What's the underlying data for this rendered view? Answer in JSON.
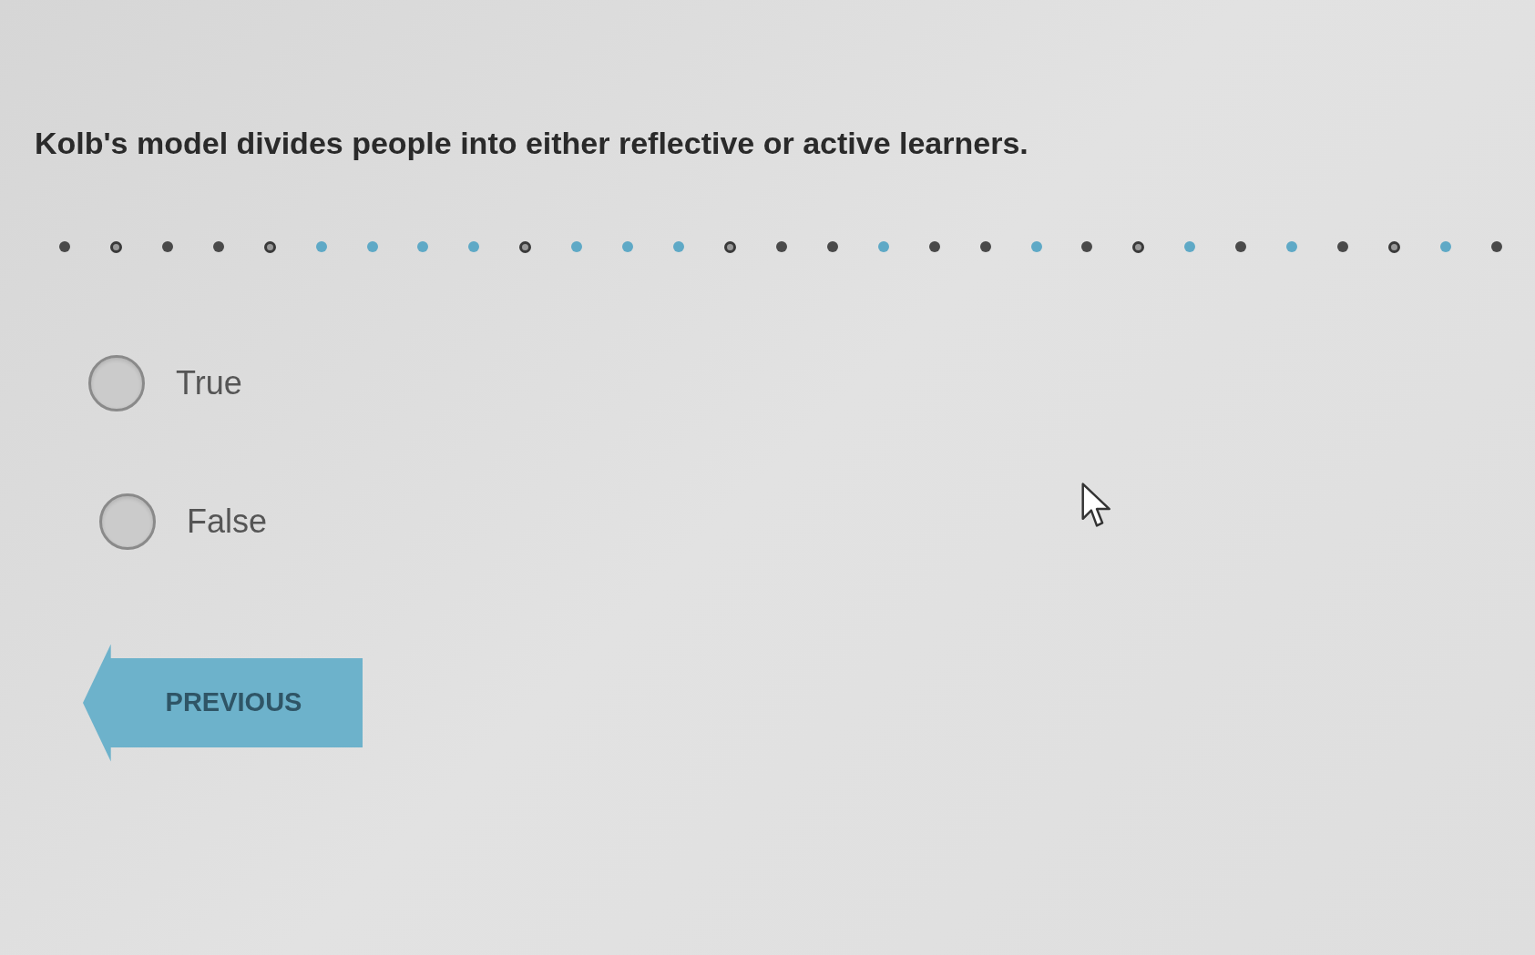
{
  "question": "Kolb's model divides people into either reflective or active learners.",
  "progress": [
    {
      "kind": "dot",
      "color": "#4a4a4a"
    },
    {
      "kind": "ring",
      "color": "#3a3a3a"
    },
    {
      "kind": "dot",
      "color": "#4a4a4a"
    },
    {
      "kind": "dot",
      "color": "#4a4a4a"
    },
    {
      "kind": "ring",
      "color": "#3a3a3a"
    },
    {
      "kind": "dot",
      "color": "#5fa9c6"
    },
    {
      "kind": "dot",
      "color": "#5fa9c6"
    },
    {
      "kind": "dot",
      "color": "#5fa9c6"
    },
    {
      "kind": "dot",
      "color": "#5fa9c6"
    },
    {
      "kind": "ring",
      "color": "#3a3a3a"
    },
    {
      "kind": "dot",
      "color": "#5fa9c6"
    },
    {
      "kind": "dot",
      "color": "#5fa9c6"
    },
    {
      "kind": "dot",
      "color": "#5fa9c6"
    },
    {
      "kind": "ring",
      "color": "#3a3a3a"
    },
    {
      "kind": "dot",
      "color": "#4a4a4a"
    },
    {
      "kind": "dot",
      "color": "#4a4a4a"
    },
    {
      "kind": "dot",
      "color": "#5fa9c6"
    },
    {
      "kind": "dot",
      "color": "#4a4a4a"
    },
    {
      "kind": "dot",
      "color": "#4a4a4a"
    },
    {
      "kind": "dot",
      "color": "#5fa9c6"
    },
    {
      "kind": "dot",
      "color": "#4a4a4a"
    },
    {
      "kind": "ring",
      "color": "#3a3a3a"
    },
    {
      "kind": "dot",
      "color": "#5fa9c6"
    },
    {
      "kind": "dot",
      "color": "#4a4a4a"
    },
    {
      "kind": "dot",
      "color": "#5fa9c6"
    },
    {
      "kind": "dot",
      "color": "#4a4a4a"
    },
    {
      "kind": "ring",
      "color": "#3a3a3a"
    },
    {
      "kind": "dot",
      "color": "#5fa9c6"
    },
    {
      "kind": "dot",
      "color": "#4a4a4a"
    }
  ],
  "options": [
    {
      "label": "True",
      "selected": false
    },
    {
      "label": "False",
      "selected": false
    }
  ],
  "buttons": [
    {
      "kind": "previous",
      "label": "PREVIOUS"
    }
  ]
}
